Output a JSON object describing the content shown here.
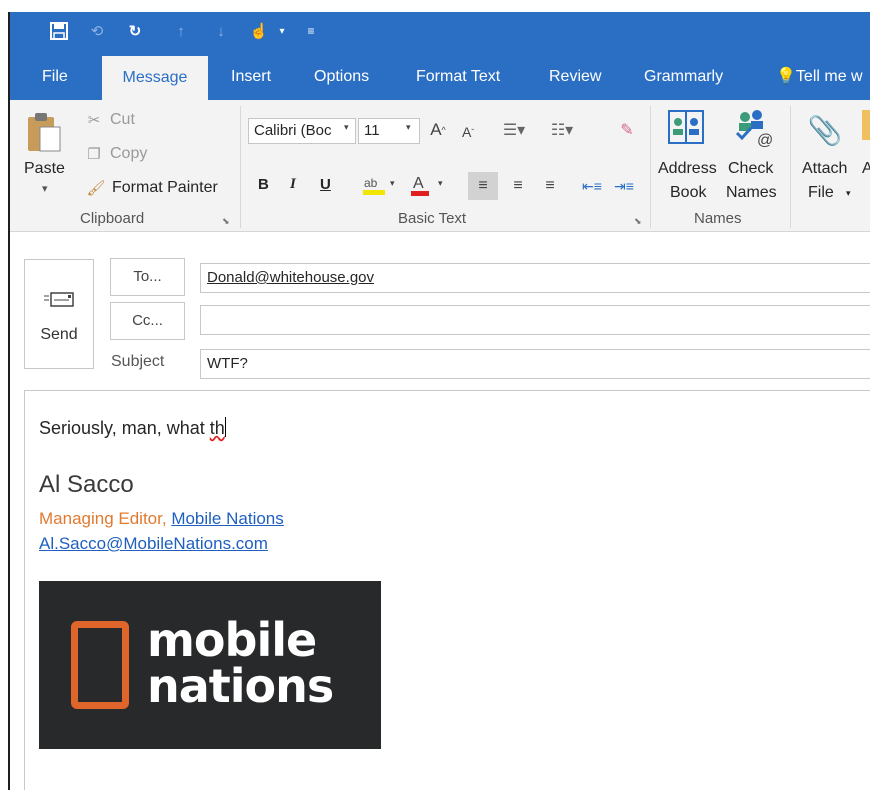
{
  "tabs": [
    "File",
    "Message",
    "Insert",
    "Options",
    "Format Text",
    "Review",
    "Grammarly",
    "Tell me w"
  ],
  "clipboard": {
    "paste_label": "Paste",
    "cut_label": "Cut",
    "copy_label": "Copy",
    "format_painter_label": "Format Painter",
    "group_label": "Clipboard"
  },
  "basic_text": {
    "font_name": "Calibri (Boc",
    "font_size": "11",
    "bold": "B",
    "italic": "I",
    "underline": "U",
    "group_label": "Basic Text"
  },
  "names": {
    "address_book_line1": "Address",
    "address_book_line2": "Book",
    "check_names_line1": "Check",
    "check_names_line2": "Names",
    "group_label": "Names"
  },
  "include": {
    "attach_line1": "Attach",
    "attach_line2": "File"
  },
  "compose": {
    "send_label": "Send",
    "to_button": "To...",
    "cc_button": "Cc...",
    "subject_label": "Subject",
    "to_value": "Donald@whitehouse.gov",
    "cc_value": "",
    "subject_value": "WTF?"
  },
  "message_body": {
    "text_before": "Seriously, man, what ",
    "text_misspelled": "th",
    "signature_name": "Al Sacco",
    "signature_title": "Managing Editor, ",
    "signature_company": "Mobile Nations",
    "signature_email": "Al.Sacco@MobileNations.com",
    "logo_line1": "mobile",
    "logo_line2": "nations"
  },
  "colors": {
    "ribbon_blue": "#2b6fc4",
    "logo_orange": "#e0652b",
    "logo_bg": "#27292a",
    "link_blue": "#1f5fbf",
    "title_orange": "#e07a30"
  }
}
